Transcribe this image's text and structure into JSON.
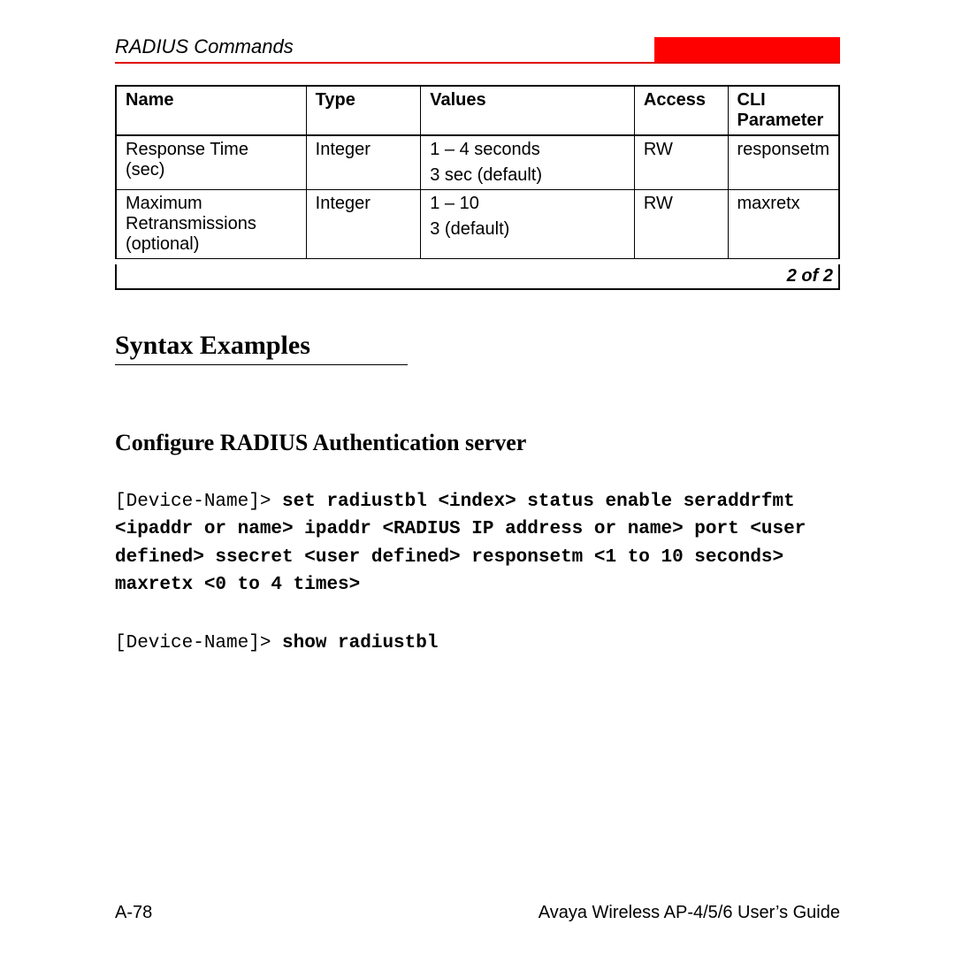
{
  "header": {
    "title": "RADIUS Commands"
  },
  "table": {
    "headers": {
      "name": "Name",
      "type": "Type",
      "values": "Values",
      "access": "Access",
      "cli": "CLI Parameter"
    },
    "rows": [
      {
        "name_l1": "Response Time",
        "name_l2": "(sec)",
        "type": "Integer",
        "values_l1": "1 – 4 seconds",
        "values_l2": "3 sec (default)",
        "access": "RW",
        "cli": "responsetm"
      },
      {
        "name_l1": "Maximum",
        "name_l2": "Retransmissions (optional)",
        "type": "Integer",
        "values_l1": "1 – 10",
        "values_l2": "3 (default)",
        "access": "RW",
        "cli": "maxretx"
      }
    ],
    "page_of": "2 of 2"
  },
  "sections": {
    "syntax_examples": "Syntax Examples",
    "configure_radius": "Configure RADIUS Authentication server"
  },
  "code": {
    "prompt1": "[Device-Name]> ",
    "cmd1": "set radiustbl <index> status enable seraddrfmt <ipaddr or name> ipaddr <RADIUS IP address or name> port <user defined> ssecret <user defined> responsetm <1 to 10 seconds> maxretx <0 to 4 times>",
    "prompt2": "[Device-Name]> ",
    "cmd2": "show radiustbl"
  },
  "footer": {
    "left": "A-78",
    "right": "Avaya Wireless AP-4/5/6 User’s Guide"
  }
}
